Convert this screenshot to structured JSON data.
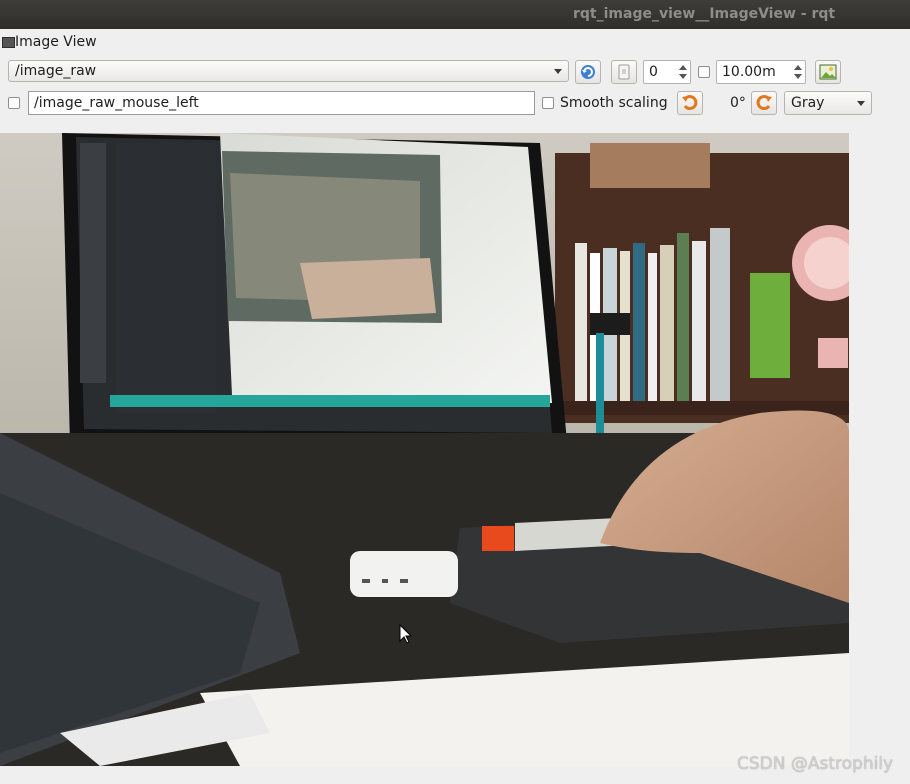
{
  "window": {
    "title": "rqt_image_view__ImageView - rqt"
  },
  "dock": {
    "title": "Image View"
  },
  "toolbar": {
    "topic": "/image_raw",
    "spin_value": "0",
    "max_range": "10.00m",
    "mouse_topic": "/image_raw_mouse_left",
    "smooth_scaling_label": "Smooth scaling",
    "rotation": "0°",
    "color_scheme": "Gray"
  },
  "watermark": "CSDN @Astrophily"
}
